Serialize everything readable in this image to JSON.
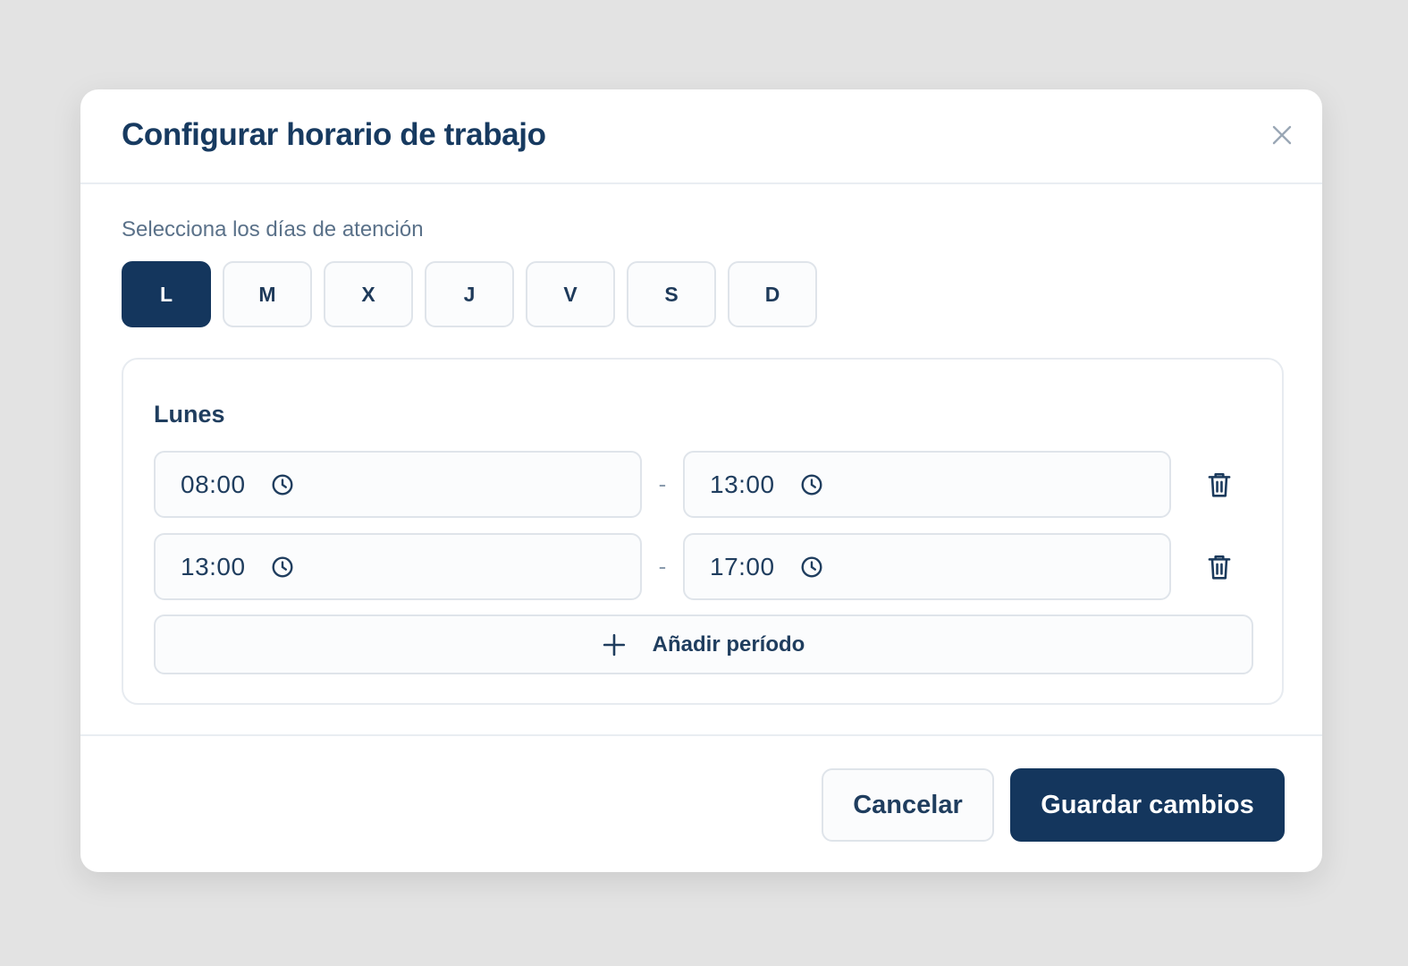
{
  "modal": {
    "title": "Configurar horario de trabajo",
    "close_icon": "close-icon"
  },
  "days_section": {
    "label": "Selecciona los días de atención",
    "days": [
      {
        "label": "L",
        "selected": true
      },
      {
        "label": "M",
        "selected": false
      },
      {
        "label": "X",
        "selected": false
      },
      {
        "label": "J",
        "selected": false
      },
      {
        "label": "V",
        "selected": false
      },
      {
        "label": "S",
        "selected": false
      },
      {
        "label": "D",
        "selected": false
      }
    ]
  },
  "day_card": {
    "title": "Lunes",
    "separator": "-",
    "periods": [
      {
        "start": "08:00",
        "end": "13:00"
      },
      {
        "start": "13:00",
        "end": "17:00"
      }
    ],
    "add_period_label": "Añadir período",
    "icons": {
      "time": "clock-icon",
      "delete": "trash-icon",
      "add": "plus-icon"
    }
  },
  "footer": {
    "cancel_label": "Cancelar",
    "save_label": "Guardar cambios"
  },
  "colors": {
    "primary": "#14365d",
    "text": "#1f3d5e",
    "muted": "#5a7189",
    "border": "#dfe4ea",
    "backdrop": "#e3e3e3"
  }
}
